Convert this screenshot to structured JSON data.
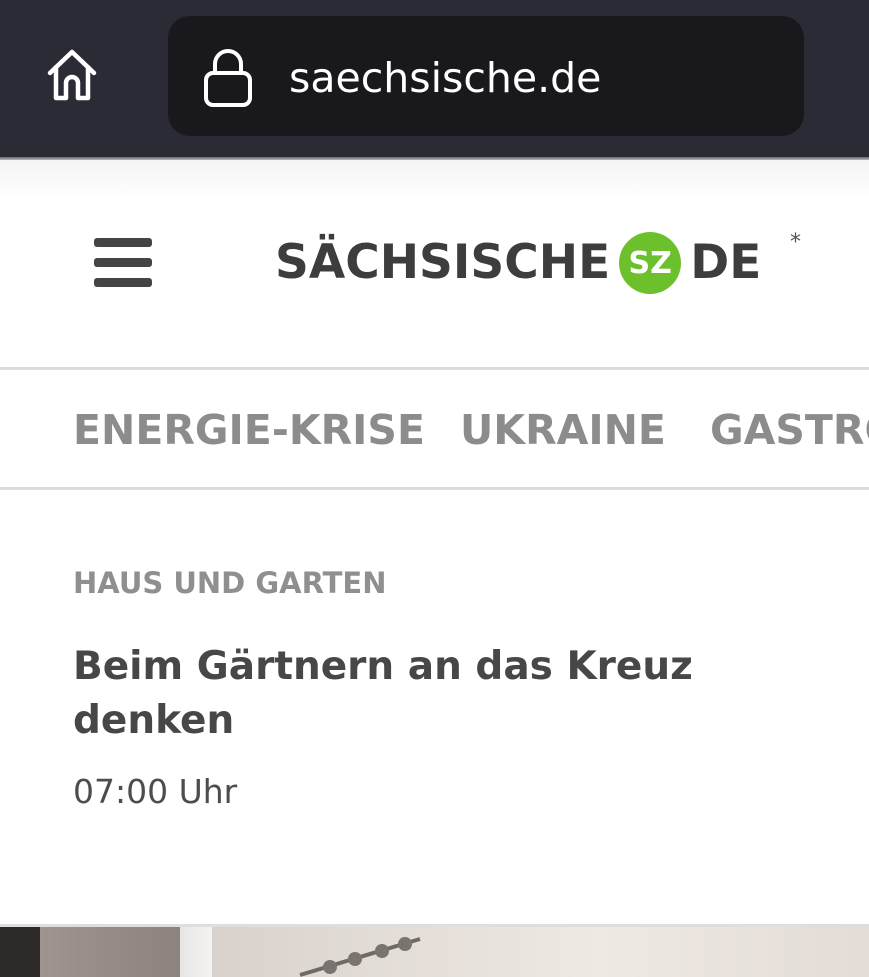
{
  "browser": {
    "url": "saechsische.de",
    "icons": {
      "home": "home-icon",
      "lock": "lock-icon"
    }
  },
  "header": {
    "logo_left": "SÄCHSISCHE",
    "logo_badge": "SZ",
    "logo_right": "DE",
    "logo_mark": "*",
    "logo_badge_color": "#6cc02b",
    "menu_icon": "hamburger-icon"
  },
  "nav": {
    "items": [
      {
        "label": "ENERGIE-KRISE"
      },
      {
        "label": "UKRAINE"
      },
      {
        "label": "GASTRO"
      }
    ]
  },
  "article": {
    "kicker": "HAUS UND GARTEN",
    "headline": "Beim Gärtnern an das Kreuz denken",
    "time": "07:00 Uhr"
  }
}
